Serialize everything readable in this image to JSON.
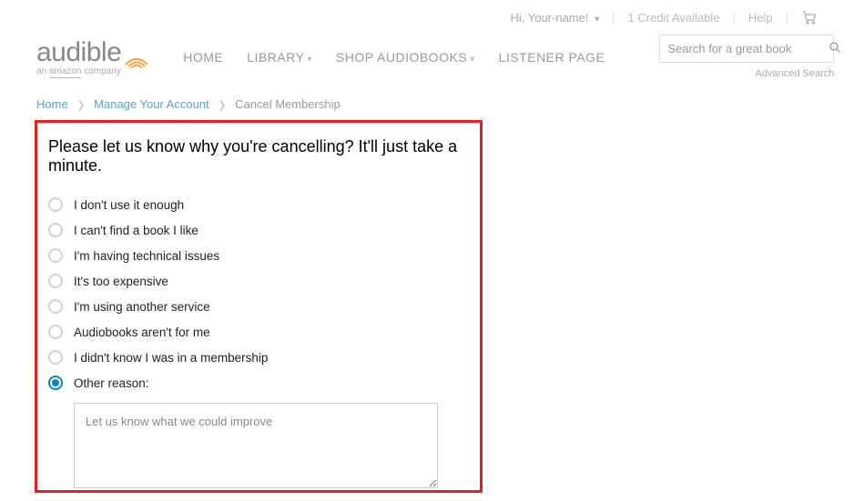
{
  "topbar": {
    "greeting": "Hi, Your-name!",
    "credit": "1 Credit Available",
    "help": "Help"
  },
  "logo": {
    "word": "audible",
    "sub_prefix": "an ",
    "sub_amazon": "amazon",
    "sub_suffix": " company"
  },
  "nav": {
    "home": "HOME",
    "library": "LIBRARY",
    "shop": "SHOP AUDIOBOOKS",
    "listener": "LISTENER PAGE"
  },
  "search": {
    "placeholder": "Search for a great book",
    "advanced": "Advanced Search"
  },
  "breadcrumb": {
    "home": "Home",
    "manage": "Manage Your Account",
    "current": "Cancel Membership"
  },
  "panel": {
    "title": "Please let us know why you're cancelling? It'll just take a minute.",
    "reasons": [
      "I don't use it enough",
      "I can't find a book I like",
      "I'm having technical issues",
      "It's too expensive",
      "I'm using another service",
      "Audiobooks aren't for me",
      "I didn't know I was in a membership",
      "Other reason:"
    ],
    "selected_index": 7,
    "textarea_placeholder": "Let us know what we could improve"
  }
}
